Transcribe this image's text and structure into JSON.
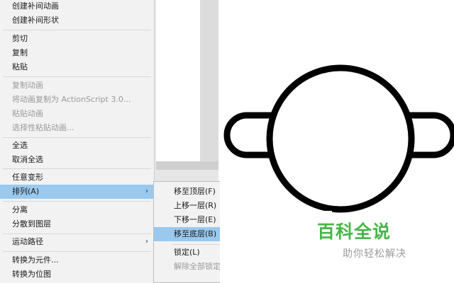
{
  "context_menu": {
    "items": [
      {
        "label": "创建补间动画",
        "disabled": false
      },
      {
        "label": "创建补间形状",
        "disabled": false
      },
      {
        "label": "剪切",
        "disabled": false
      },
      {
        "label": "复制",
        "disabled": false
      },
      {
        "label": "粘贴",
        "disabled": false
      },
      {
        "label": "复制动画",
        "disabled": true
      },
      {
        "label": "将动画复制为 ActionScript 3.0...",
        "disabled": true
      },
      {
        "label": "粘贴动画",
        "disabled": true
      },
      {
        "label": "选择性粘贴动画...",
        "disabled": true
      },
      {
        "label": "全选",
        "disabled": false
      },
      {
        "label": "取消全选",
        "disabled": false
      },
      {
        "label": "任意变形",
        "disabled": false
      },
      {
        "label": "排列(A)",
        "disabled": false,
        "highlighted": true,
        "has_submenu": true
      },
      {
        "label": "分离",
        "disabled": false
      },
      {
        "label": "分散到图层",
        "disabled": false
      },
      {
        "label": "运动路径",
        "disabled": false,
        "has_submenu": true
      },
      {
        "label": "转换为元件...",
        "disabled": false
      },
      {
        "label": "转换为位图",
        "disabled": false
      }
    ],
    "submenu_arrow": "›"
  },
  "arrange_submenu": {
    "items": [
      {
        "label": "移至顶层(F)",
        "disabled": false
      },
      {
        "label": "上移一层(R)",
        "disabled": false
      },
      {
        "label": "下移一层(E)",
        "disabled": false
      },
      {
        "label": "移至底层(B)",
        "disabled": false,
        "highlighted": true
      },
      {
        "label": "锁定(L)",
        "disabled": false
      },
      {
        "label": "解除全部锁定",
        "disabled": true
      }
    ]
  },
  "watermark": {
    "title": "百科全说",
    "subtitle": "助你轻松解决"
  },
  "colors": {
    "menu_bg": "#f2f2f2",
    "highlight": "#99c9ef",
    "disabled_text": "#9a9a9a",
    "watermark_green": "#47b548",
    "shape_stroke": "#000000"
  }
}
